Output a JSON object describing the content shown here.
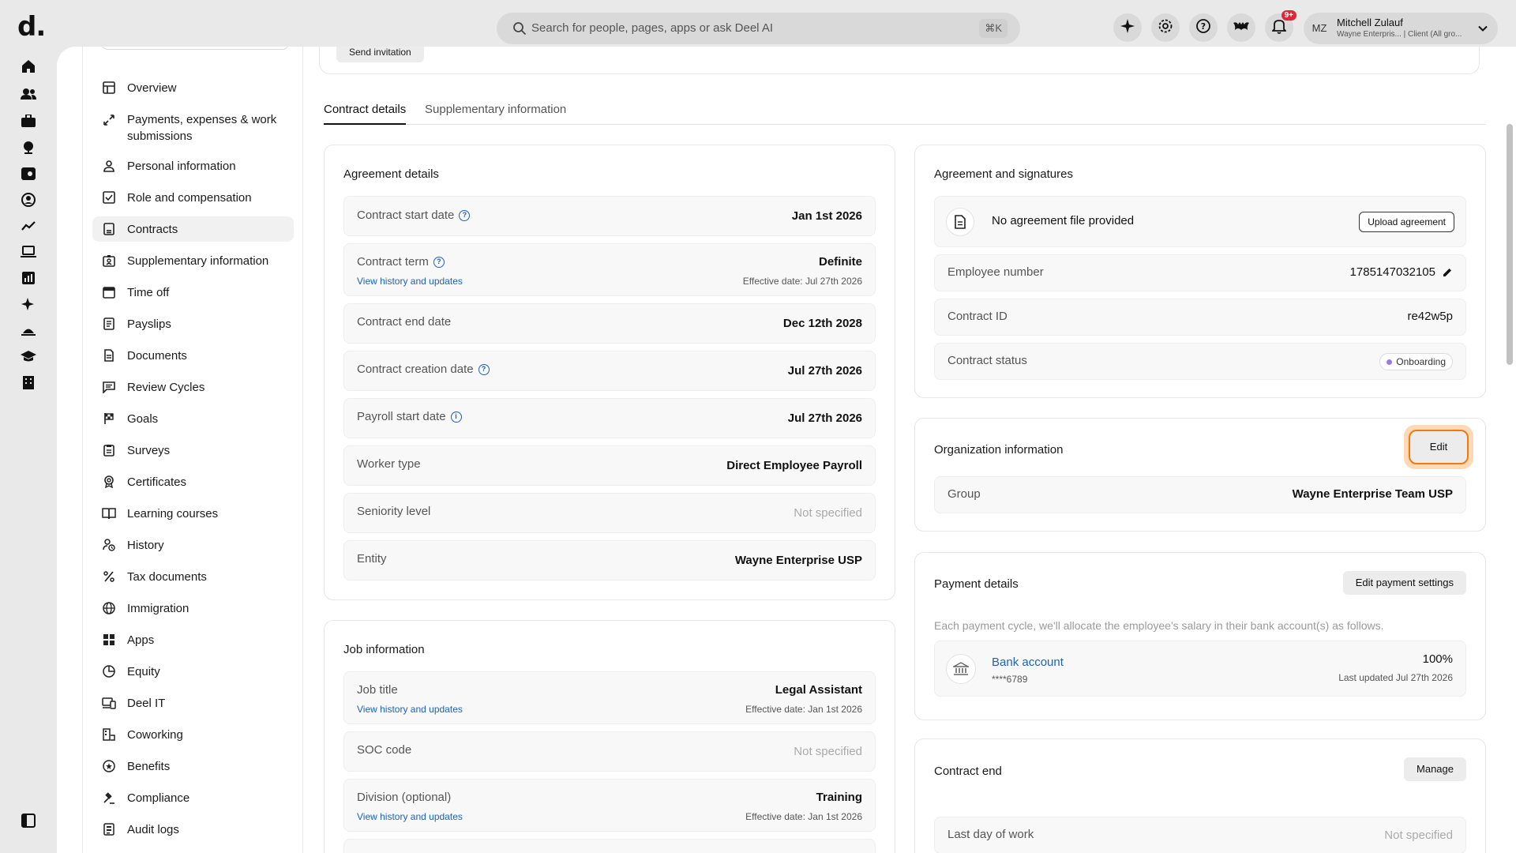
{
  "app": {
    "logo": "d."
  },
  "search": {
    "placeholder": "Search for people, pages, apps or ask Deel AI",
    "shortcut": "⌘K"
  },
  "notifications": {
    "badge": "9+"
  },
  "user": {
    "initials": "MZ",
    "name": "Mitchell Zulauf",
    "subtitle": "Wayne Enterpris... | Client (All gro..."
  },
  "rail_icons": [
    "home-icon",
    "people-icon",
    "briefcase-icon",
    "globe-icon",
    "wallet-icon",
    "user-circle-icon",
    "trend-icon",
    "laptop-icon",
    "chart-icon",
    "sparkle-icon",
    "island-icon",
    "graduation-icon",
    "building-icon"
  ],
  "subnav": {
    "items": [
      {
        "label": "Overview",
        "icon": "layout-icon"
      },
      {
        "label": "Payments, expenses & work submissions",
        "icon": "arrows-icon"
      },
      {
        "label": "Personal information",
        "icon": "user-icon"
      },
      {
        "label": "Role and compensation",
        "icon": "checklist-icon"
      },
      {
        "label": "Contracts",
        "icon": "contract-icon"
      },
      {
        "label": "Supplementary information",
        "icon": "id-card-icon"
      },
      {
        "label": "Time off",
        "icon": "calendar-icon"
      },
      {
        "label": "Payslips",
        "icon": "payslip-icon"
      },
      {
        "label": "Documents",
        "icon": "document-icon"
      },
      {
        "label": "Review Cycles",
        "icon": "chat-icon"
      },
      {
        "label": "Goals",
        "icon": "flag-icon"
      },
      {
        "label": "Surveys",
        "icon": "survey-icon"
      },
      {
        "label": "Certificates",
        "icon": "certificate-icon"
      },
      {
        "label": "Learning courses",
        "icon": "book-icon"
      },
      {
        "label": "History",
        "icon": "history-icon"
      },
      {
        "label": "Tax documents",
        "icon": "percent-icon"
      },
      {
        "label": "Immigration",
        "icon": "globe-icon"
      },
      {
        "label": "Apps",
        "icon": "apps-icon"
      },
      {
        "label": "Equity",
        "icon": "pie-icon"
      },
      {
        "label": "Deel IT",
        "icon": "devices-icon"
      },
      {
        "label": "Coworking",
        "icon": "coworking-icon"
      },
      {
        "label": "Benefits",
        "icon": "star-circle-icon"
      },
      {
        "label": "Compliance",
        "icon": "gavel-icon"
      },
      {
        "label": "Audit logs",
        "icon": "audit-icon"
      }
    ]
  },
  "header": {
    "send_invitation": "Send invitation"
  },
  "tabs": [
    {
      "label": "Contract details",
      "active": true
    },
    {
      "label": "Supplementary information",
      "active": false
    }
  ],
  "agreement_details": {
    "title": "Agreement details",
    "contract_start": {
      "label": "Contract start date",
      "value": "Jan 1st 2026"
    },
    "contract_term": {
      "label": "Contract term",
      "value": "Definite",
      "link": "View history and updates",
      "sub": "Effective date: Jul 27th 2026"
    },
    "contract_end": {
      "label": "Contract end date",
      "value": "Dec 12th 2028"
    },
    "contract_creation": {
      "label": "Contract creation date",
      "value": "Jul 27th 2026"
    },
    "payroll_start": {
      "label": "Payroll start date",
      "value": "Jul 27th 2026"
    },
    "worker_type": {
      "label": "Worker type",
      "value": "Direct Employee Payroll"
    },
    "seniority": {
      "label": "Seniority level",
      "value": "Not specified"
    },
    "entity": {
      "label": "Entity",
      "value": "Wayne Enterprise USP"
    }
  },
  "job_information": {
    "title": "Job information",
    "job_title": {
      "label": "Job title",
      "value": "Legal Assistant",
      "link": "View history and updates",
      "sub": "Effective date: Jan 1st 2026"
    },
    "soc_code": {
      "label": "SOC code",
      "value": "Not specified"
    },
    "division": {
      "label": "Division (optional)",
      "value": "Training",
      "link": "View history and updates",
      "sub": "Effective date: Jan 1st 2026"
    }
  },
  "agreement_signatures": {
    "title": "Agreement and signatures",
    "no_file": "No agreement file provided",
    "upload_label": "Upload agreement",
    "employee_number": {
      "label": "Employee number",
      "value": "1785147032105"
    },
    "contract_id": {
      "label": "Contract ID",
      "value": "re42w5p"
    },
    "contract_status": {
      "label": "Contract status",
      "value": "Onboarding"
    }
  },
  "organization": {
    "title": "Organization information",
    "edit_label": "Edit",
    "group": {
      "label": "Group",
      "value": "Wayne Enterprise Team USP"
    }
  },
  "payment": {
    "title": "Payment details",
    "edit_label": "Edit payment settings",
    "description": "Each payment cycle, we'll allocate the employee's salary in their bank account(s) as follows.",
    "bank": {
      "name": "Bank account",
      "masked": "****6789",
      "percent": "100%",
      "updated": "Last updated Jul 27th 2026"
    }
  },
  "contract_end": {
    "title": "Contract end",
    "manage_label": "Manage",
    "last_day": {
      "label": "Last day of work",
      "value": "Not specified"
    }
  },
  "colors": {
    "accent_link": "#1f62b4",
    "focus_ring": "#f07a10",
    "status_dot": "#9b7be0",
    "badge_red": "#e0243a"
  }
}
